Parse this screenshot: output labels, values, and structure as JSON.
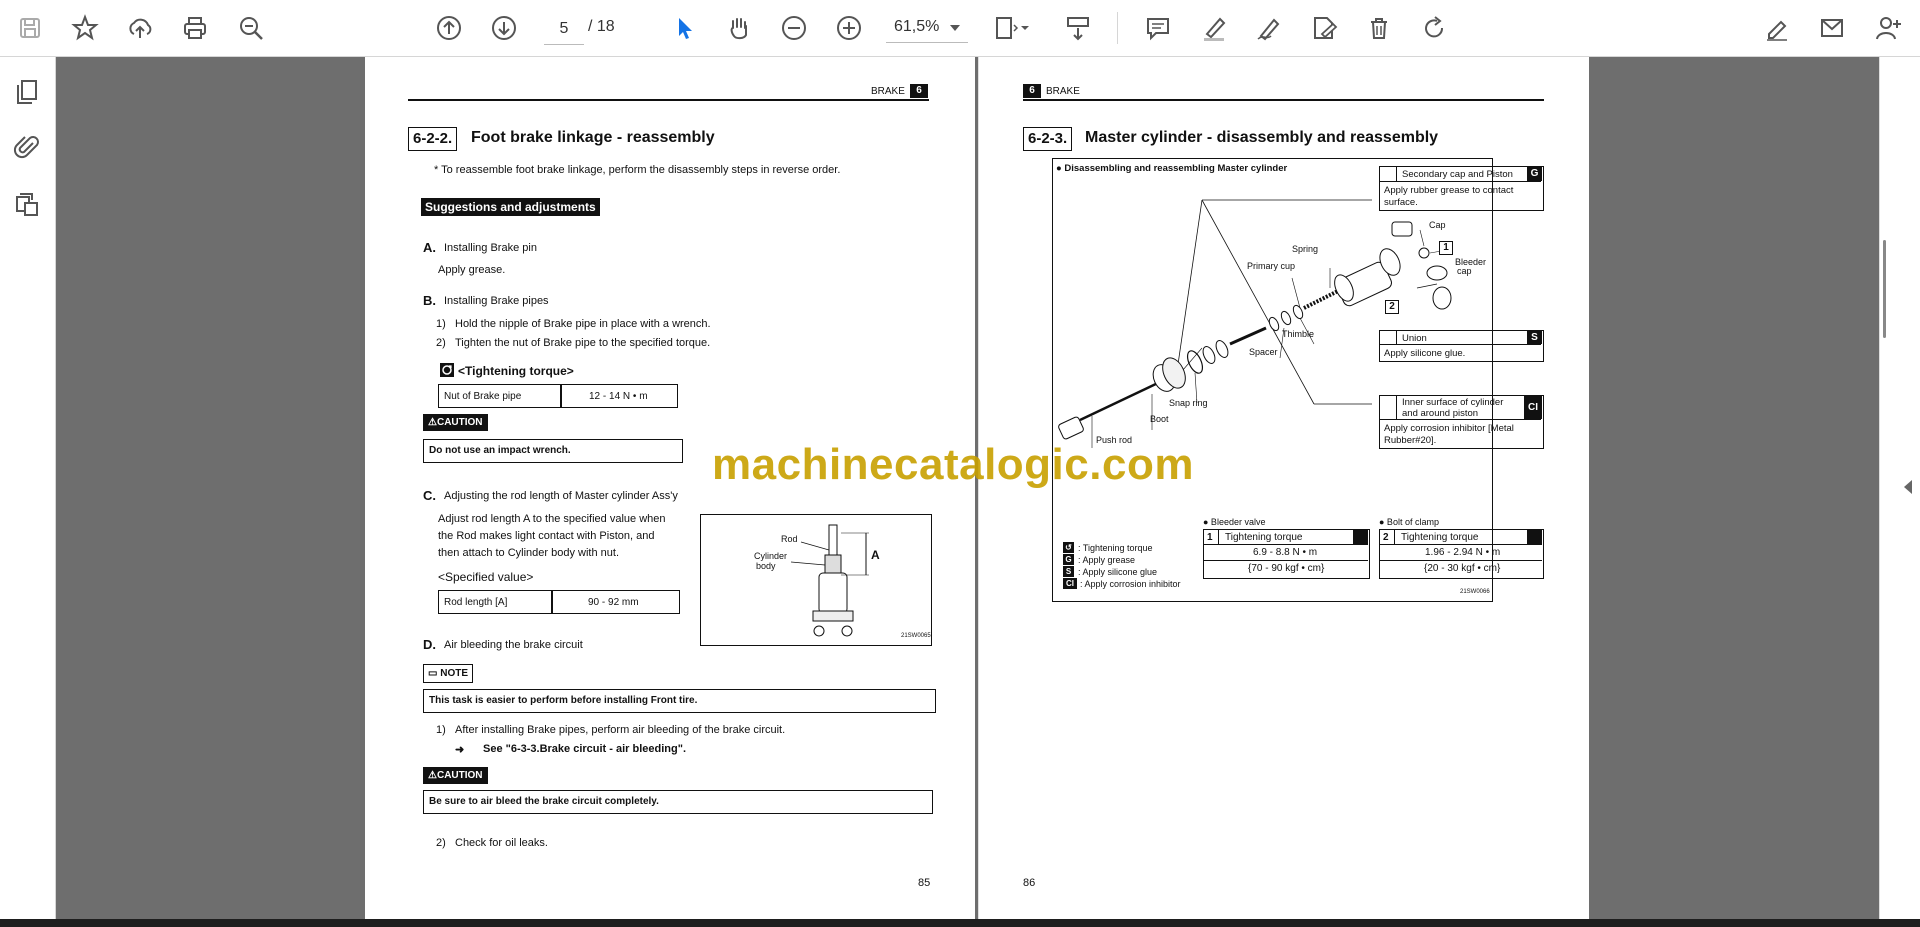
{
  "toolbar": {
    "current_page": "5",
    "page_total": "/ 18",
    "zoom": "61,5%",
    "icons": [
      "save-icon",
      "star-icon",
      "upload-cloud-icon",
      "print-icon",
      "zoom-search-icon",
      "page-up-icon",
      "page-down-icon",
      "select-cursor-icon",
      "hand-icon",
      "zoom-out-icon",
      "zoom-in-icon",
      "fit-page-icon",
      "scroll-mode-icon",
      "comment-icon",
      "highlight-pen-icon",
      "draw-icon",
      "stamp-icon",
      "delete-icon",
      "rotate-icon",
      "link-sign-icon",
      "email-icon",
      "add-user-icon"
    ]
  },
  "sidebar": {
    "icons": [
      "page-thumbnails-icon",
      "attachment-icon",
      "layers-icon"
    ]
  },
  "page85": {
    "header_text": "BRAKE",
    "header_badge": "6",
    "section_num": "6-2-2.",
    "section_title": "Foot brake linkage - reassembly",
    "intro": "*  To reassemble foot brake linkage, perform the disassembly steps in reverse order.",
    "suggestions_label": "Suggestions and adjustments",
    "a_letter": "A.",
    "a_title": "Installing Brake pin",
    "a_text": "Apply grease.",
    "b_letter": "B.",
    "b_title": "Installing Brake pipes",
    "b_step1_num": "1)",
    "b_step1": "Hold the nipple of Brake pipe in place with a wrench.",
    "b_step2_num": "2)",
    "b_step2": "Tighten the nut of Brake pipe to the specified torque.",
    "torque_label": "<Tightening torque>",
    "torque_item": "Nut of Brake pipe",
    "torque_value": "12 - 14 N • m",
    "caution_label": "CAUTION",
    "caution1_text": "Do not use an impact wrench.",
    "c_letter": "C.",
    "c_title": "Adjusting the rod length of Master cylinder Ass'y",
    "c_line1": "Adjust rod length A to the specified value when",
    "c_line2": "the Rod makes light contact with Piston, and",
    "c_line3": "then attach to Cylinder body with nut.",
    "spec_label": "<Specified value>",
    "spec_item": "Rod length [A]",
    "spec_value": "90 - 92 mm",
    "fig_rod": "Rod",
    "fig_cylinder": "Cylinder",
    "fig_body": "body",
    "fig_a": "A",
    "fig_code": "21SW0065",
    "d_letter": "D.",
    "d_title": "Air bleeding the brake circuit",
    "note_label": "NOTE",
    "note_text": "This task is easier to perform before installing Front tire.",
    "d_step1_num": "1)",
    "d_step1": "After installing Brake pipes, perform air bleeding of the brake circuit.",
    "d_ref": "See \"6-3-3.Brake circuit - air bleeding\".",
    "caution2_text": "Be sure to air bleed the brake circuit completely.",
    "d_step2_num": "2)",
    "d_step2": "Check for oil leaks.",
    "page_number": "85"
  },
  "page86": {
    "header_badge": "6",
    "header_text": "BRAKE",
    "section_num": "6-2-3.",
    "section_title": "Master cylinder - disassembly and reassembly",
    "diagram_title": "●  Disassembling and reassembling Master cylinder",
    "g_title": "Secondary cap and Piston",
    "g_badge": "G",
    "g_text1": "Apply rubber grease to contact",
    "g_text2": "surface.",
    "s_title": "Union",
    "s_badge": "S",
    "s_text": "Apply silicone glue.",
    "ci_title1": "Inner surface of cylinder",
    "ci_title2": "and around piston",
    "ci_badge": "CI",
    "ci_text1": "Apply corrosion inhibitor [Metal",
    "ci_text2": "Rubber#20].",
    "parts": {
      "cap": "Cap",
      "spring": "Spring",
      "primary_cup": "Primary cup",
      "bleeder_cap1": "Bleeder",
      "bleeder_cap2": "cap",
      "thimble": "Thimble",
      "spacer": "Spacer",
      "snap_ring": "Snap ring",
      "boot": "Boot",
      "push_rod": "Push rod"
    },
    "legend": [
      {
        "badge": "↺",
        "text": ": Tightening torque"
      },
      {
        "badge": "G",
        "text": ": Apply grease"
      },
      {
        "badge": "S",
        "text": ": Apply silicone glue"
      },
      {
        "badge": "CI",
        "text": ": Apply corrosion inhibitor"
      }
    ],
    "bleeder_heading": "●  Bleeder valve",
    "bleeder_num": "1",
    "bleeder_label": "Tightening torque",
    "bleeder_nm": "6.9 - 8.8 N • m",
    "bleeder_kgf": "{70 - 90 kgf • cm}",
    "clamp_heading": "●  Bolt of clamp",
    "clamp_num": "2",
    "clamp_label": "Tightening torque",
    "clamp_nm": "1.96 - 2.94 N • m",
    "clamp_kgf": "{20 - 30 kgf • cm}",
    "fig_code": "21SW0066",
    "callout1": "1",
    "callout2": "2",
    "page_number": "86"
  },
  "watermark": "machinecatalogic.com"
}
